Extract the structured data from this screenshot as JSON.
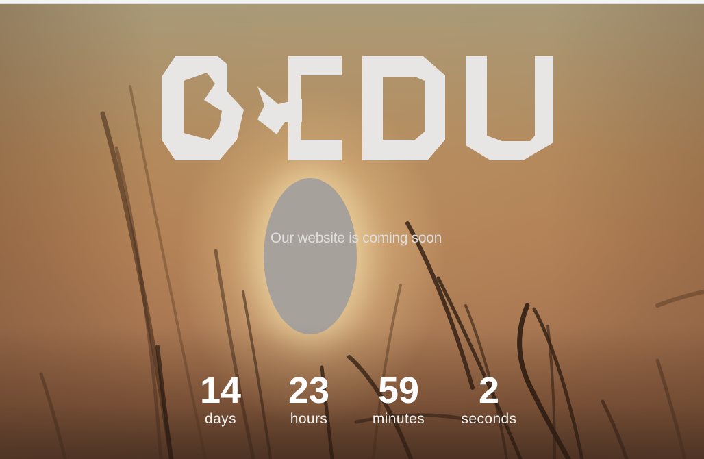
{
  "logo": {
    "text": "BEDU"
  },
  "tagline": "Our website is coming soon",
  "countdown": [
    {
      "value": "14",
      "label": "days"
    },
    {
      "value": "23",
      "label": "hours"
    },
    {
      "value": "59",
      "label": "minutes"
    },
    {
      "value": "2",
      "label": "seconds"
    }
  ],
  "colors": {
    "logo": "#e8e6e5",
    "countdown_text": "#ffffff",
    "tagline_text": "#dedede",
    "background_warm": "#b07d53"
  }
}
